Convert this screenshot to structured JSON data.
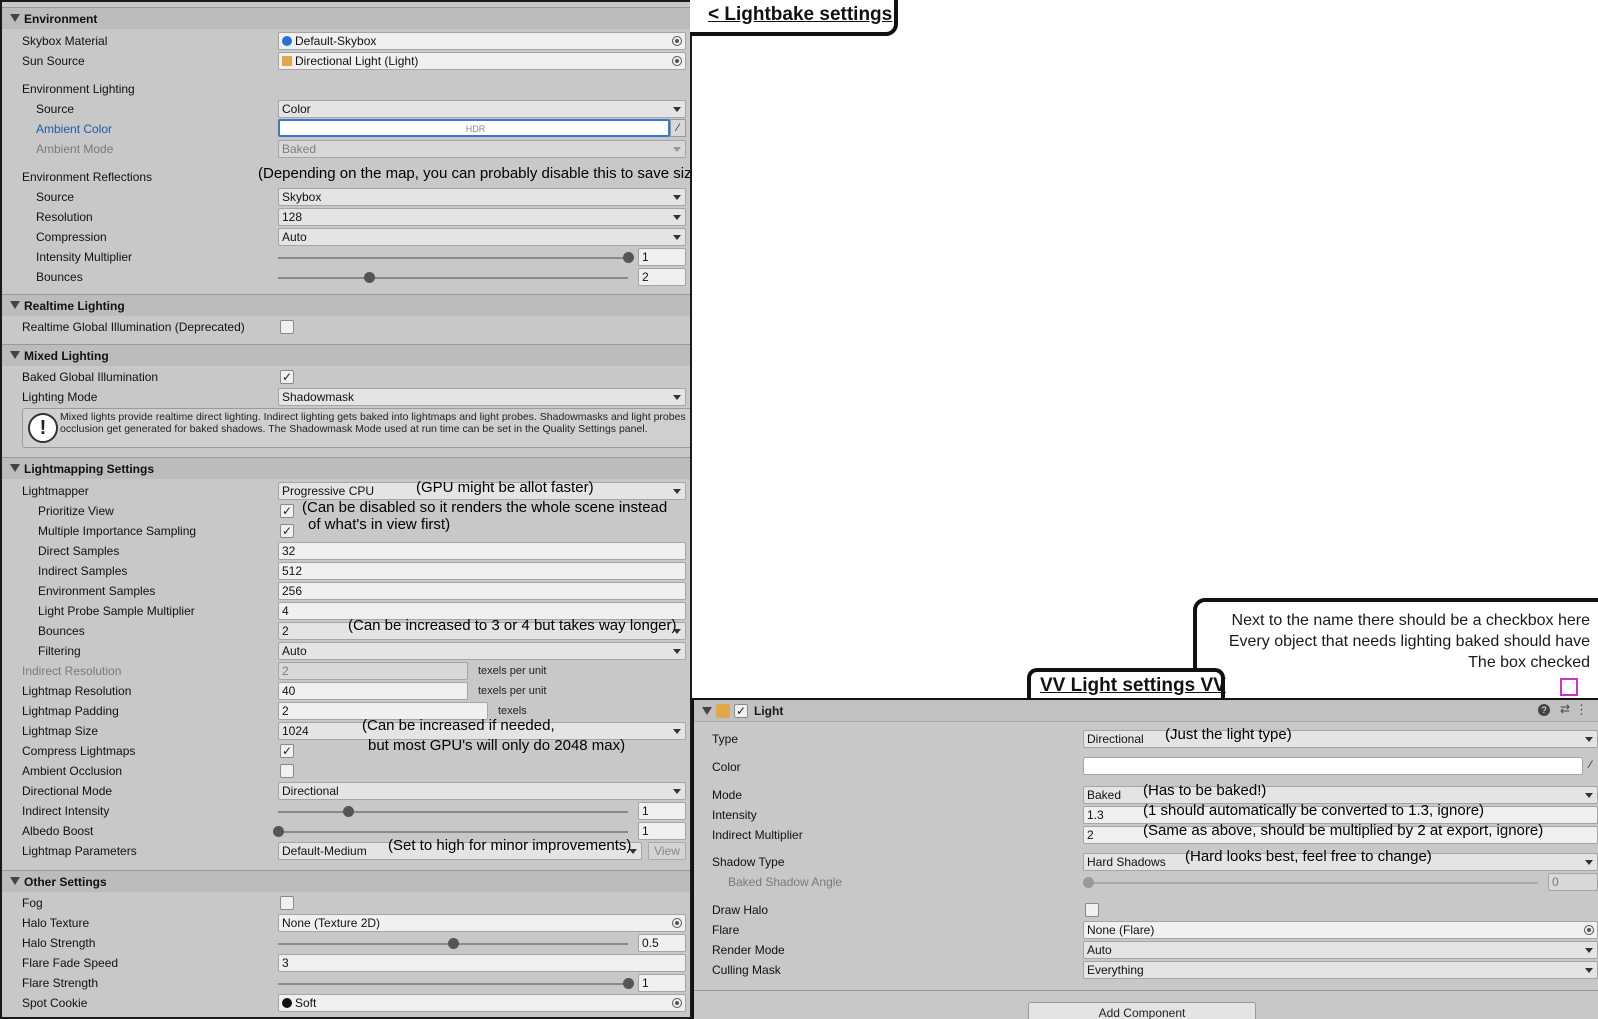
{
  "env": {
    "header": "Environment",
    "skybox_label": "Skybox Material",
    "skybox_value": "Default-Skybox",
    "sun_label": "Sun Source",
    "sun_value": "Directional Light (Light)",
    "env_lighting_label": "Environment Lighting",
    "source_label": "Source",
    "source_value": "Color",
    "ambient_color_label": "Ambient Color",
    "ambient_color_value": "HDR",
    "ambient_mode_label": "Ambient Mode",
    "ambient_mode_value": "Baked",
    "reflections_label": "Environment Reflections",
    "reflections_note": "(Depending on the map, you can probably disable this to save size)",
    "refl_source_label": "Source",
    "refl_source_value": "Skybox",
    "resolution_label": "Resolution",
    "resolution_value": "128",
    "compression_label": "Compression",
    "compression_value": "Auto",
    "intensity_label": "Intensity Multiplier",
    "intensity_value": "1",
    "intensity_fraction": 1.0,
    "bounces_label": "Bounces",
    "bounces_value": "2",
    "bounces_fraction": 0.26
  },
  "realtime": {
    "header": "Realtime Lighting",
    "gi_label": "Realtime Global Illumination (Deprecated)",
    "gi_checked": false
  },
  "mixed": {
    "header": "Mixed Lighting",
    "baked_gi_label": "Baked Global Illumination",
    "baked_gi_checked": true,
    "mode_label": "Lighting Mode",
    "mode_value": "Shadowmask",
    "help_icon": "!",
    "help_text": "Mixed lights provide realtime direct lighting. Indirect lighting gets baked into lightmaps and light probes. Shadowmasks and light probes occlusion get generated for baked shadows. The Shadowmask Mode used at run time can be set in the Quality Settings panel."
  },
  "lightmapping": {
    "header": "Lightmapping Settings",
    "lightmapper_label": "Lightmapper",
    "lightmapper_value": "Progressive CPU",
    "lightmapper_note": "(GPU might be allot faster)",
    "prioritize_label": "Prioritize View",
    "prioritize_note_1": "(Can be disabled so it renders the whole scene instead",
    "prioritize_note_2": "of what's in view first)",
    "mis_label": "Multiple Importance Sampling",
    "direct_label": "Direct Samples",
    "direct_value": "32",
    "indirect_label": "Indirect Samples",
    "indirect_value": "512",
    "env_samples_label": "Environment Samples",
    "env_samples_value": "256",
    "probe_mult_label": "Light Probe Sample Multiplier",
    "probe_mult_value": "4",
    "bounces_label": "Bounces",
    "bounces_value": "2",
    "bounces_note": "(Can be increased to 3 or 4 but takes way longer)",
    "filtering_label": "Filtering",
    "filtering_value": "Auto",
    "indirect_res_label": "Indirect Resolution",
    "indirect_res_value": "2",
    "texels_per_unit": "texels per unit",
    "lm_res_label": "Lightmap Resolution",
    "lm_res_value": "40",
    "lm_padding_label": "Lightmap Padding",
    "lm_padding_value": "2",
    "texels": "texels",
    "lm_size_label": "Lightmap Size",
    "lm_size_value": "1024",
    "lm_size_note_1": "(Can be increased if needed,",
    "lm_size_note_2": "but most GPU's will only do 2048 max)",
    "compress_label": "Compress Lightmaps",
    "ao_label": "Ambient Occlusion",
    "dir_mode_label": "Directional Mode",
    "dir_mode_value": "Directional",
    "ind_intensity_label": "Indirect Intensity",
    "ind_intensity_value": "1",
    "ind_intensity_fraction": 0.2,
    "albedo_label": "Albedo Boost",
    "albedo_value": "1",
    "albedo_fraction": 0.0,
    "params_label": "Lightmap Parameters",
    "params_value": "Default-Medium",
    "params_note": "(Set to high for minor improvements)",
    "view_button": "View"
  },
  "other": {
    "header": "Other Settings",
    "fog_label": "Fog",
    "halo_tex_label": "Halo Texture",
    "halo_tex_value": "None (Texture 2D)",
    "halo_strength_label": "Halo Strength",
    "halo_strength_value": "0.5",
    "halo_strength_fraction": 0.5,
    "flare_fade_label": "Flare Fade Speed",
    "flare_fade_value": "3",
    "flare_strength_label": "Flare Strength",
    "flare_strength_value": "1",
    "flare_strength_fraction": 1.0,
    "spot_cookie_label": "Spot Cookie",
    "spot_cookie_value": "Soft"
  },
  "callouts": {
    "lightbake": "< Lightbake settings",
    "checkbox_note_1": "Next to the name there should be a checkbox here",
    "checkbox_note_2": "Every object that needs lighting baked should have",
    "checkbox_note_3": "The box checked",
    "light_settings": "VV Light settings VV"
  },
  "light": {
    "title": "Light",
    "enabled": true,
    "type_label": "Type",
    "type_value": "Directional",
    "type_note": "(Just the light type)",
    "color_label": "Color",
    "mode_label": "Mode",
    "mode_value": "Baked",
    "mode_note": "(Has to be baked!)",
    "intensity_label": "Intensity",
    "intensity_value": "1.3",
    "intensity_note": "(1 should automatically be converted to 1.3, ignore)",
    "ind_mult_label": "Indirect Multiplier",
    "ind_mult_value": "2",
    "ind_mult_note": "(Same as above, should be multiplied by 2 at export, ignore)",
    "shadow_label": "Shadow Type",
    "shadow_value": "Hard Shadows",
    "shadow_note": "(Hard looks best, feel free to change)",
    "shadow_angle_label": "Baked Shadow Angle",
    "shadow_angle_value": "0",
    "halo_label": "Draw Halo",
    "flare_label": "Flare",
    "flare_value": "None (Flare)",
    "render_mode_label": "Render Mode",
    "render_mode_value": "Auto",
    "culling_label": "Culling Mask",
    "culling_value": "Everything",
    "add_component": "Add Component"
  },
  "colors": {
    "panel_bg": "#c8c8c8",
    "ambient_label": "#1d5ca8",
    "magenta": "#d22cd2"
  }
}
